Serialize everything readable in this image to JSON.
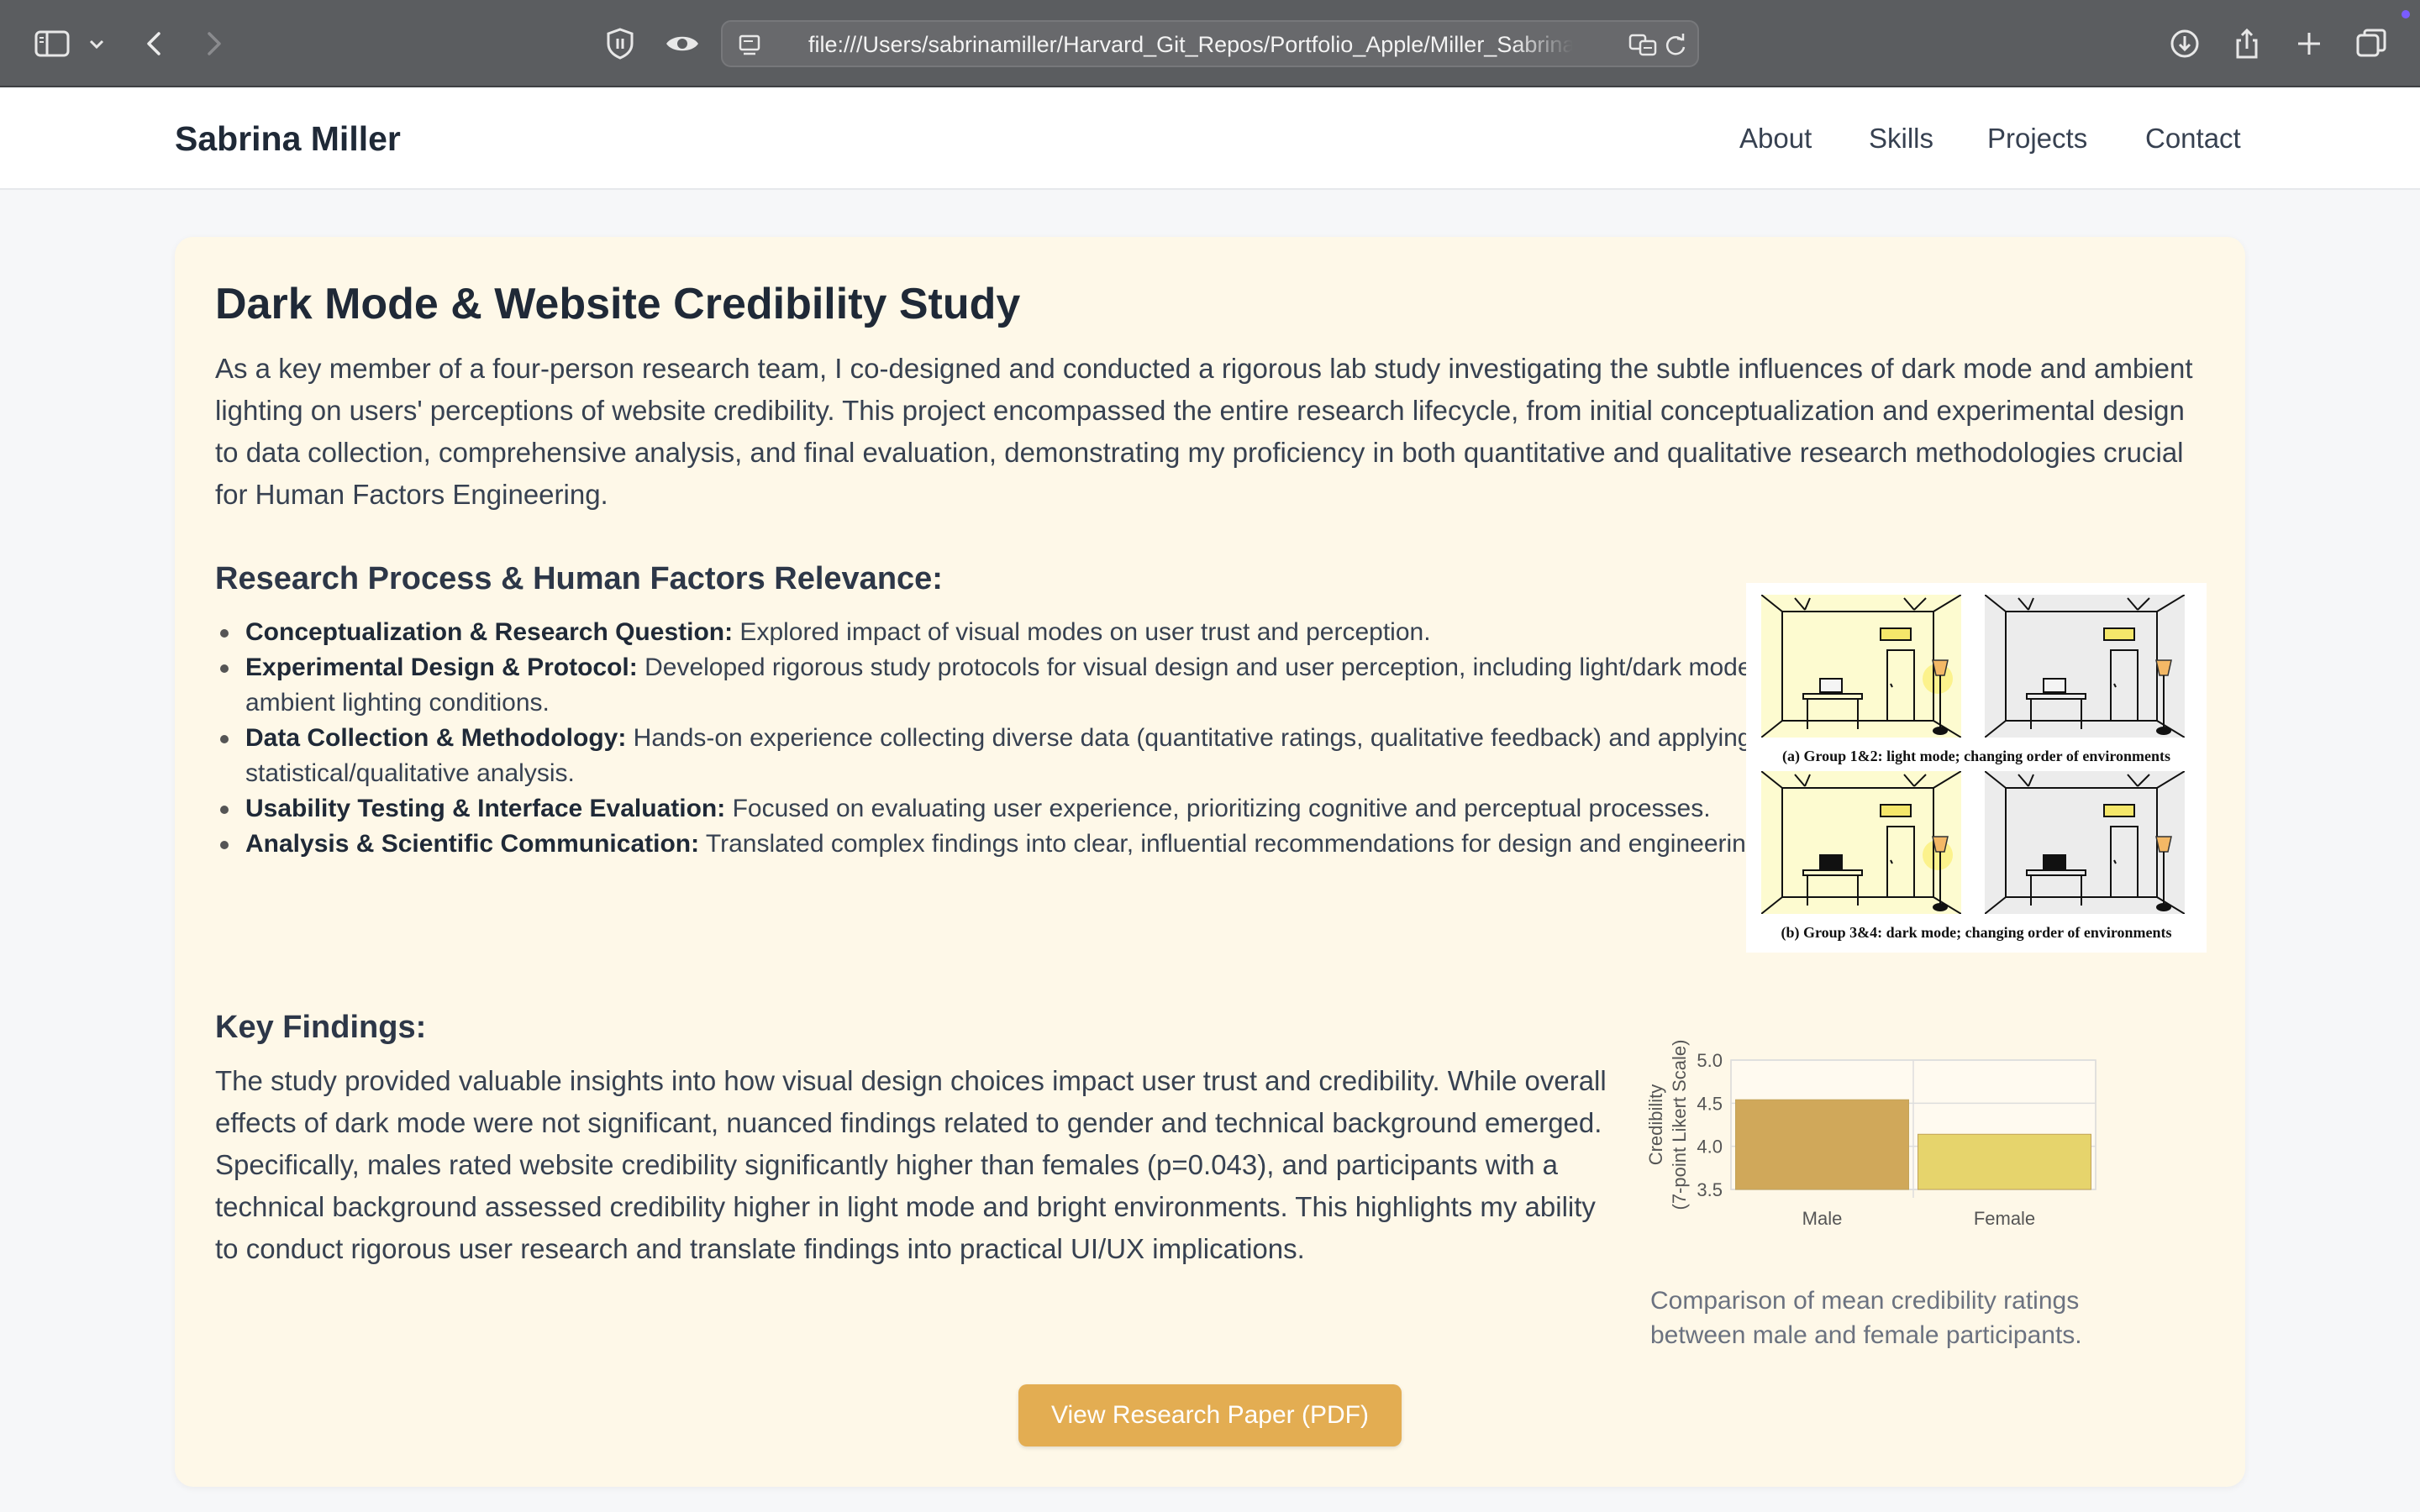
{
  "browser": {
    "url": "file:///Users/sabrinamiller/Harvard_Git_Repos/Portfolio_Apple/Miller_Sabrina_Portfolio.html",
    "icons": [
      "sidebar-icon",
      "chevron-down-icon",
      "back-icon",
      "forward-icon",
      "shield-icon",
      "eye-icon",
      "page-icon",
      "translate-icon",
      "reload-icon",
      "download-icon",
      "share-icon",
      "plus-icon",
      "tabs-icon"
    ]
  },
  "site": {
    "brand": "Sabrina Miller",
    "nav": [
      "About",
      "Skills",
      "Projects",
      "Contact"
    ]
  },
  "project": {
    "title": "Dark Mode & Website Credibility Study",
    "intro": "As a key member of a four-person research team, I co-designed and conducted a rigorous lab study investigating the subtle influences of dark mode and ambient lighting on users' perceptions of website credibility. This project encompassed the entire research lifecycle, from initial conceptualization and experimental design to data collection, comprehensive analysis, and final evaluation, demonstrating my proficiency in both quantitative and qualitative research methodologies crucial for Human Factors Engineering.",
    "process_title": "Research Process & Human Factors Relevance:",
    "bullets": [
      {
        "label": "Conceptualization & Research Question:",
        "text": " Explored impact of visual modes on user trust and perception."
      },
      {
        "label": "Experimental Design & Protocol:",
        "text": " Developed rigorous study protocols for visual design and user perception, including light/dark mode and ambient lighting conditions."
      },
      {
        "label": "Data Collection & Methodology:",
        "text": " Hands-on experience collecting diverse data (quantitative ratings, qualitative feedback) and applying advanced statistical/qualitative analysis."
      },
      {
        "label": "Usability Testing & Interface Evaluation:",
        "text": " Focused on evaluating user experience, prioritizing cognitive and perceptual processes."
      },
      {
        "label": "Analysis & Scientific Communication:",
        "text": " Translated complex findings into clear, influential recommendations for design and engineering teams."
      }
    ],
    "figure": {
      "caption_a": "(a) Group 1&2: light mode; changing order of environments",
      "caption_b": "(b) Group 3&4: dark mode; changing order of environments"
    },
    "findings_title": "Key Findings:",
    "findings": "The study provided valuable insights into how visual design choices impact user trust and credibility. While overall effects of dark mode were not significant, nuanced findings related to gender and technical background emerged. Specifically, males rated website credibility significantly higher than females (p=0.043), and participants with a technical background assessed credibility higher in light mode and bright environments. This highlights my ability to conduct rigorous user research and translate findings into practical UI/UX implications.",
    "chart_caption": "Comparison of mean credibility ratings between male and female participants.",
    "pdf_button": "View Research Paper (PDF)"
  },
  "chart_data": {
    "type": "bar",
    "categories": [
      "Male",
      "Female"
    ],
    "values": [
      4.54,
      4.14
    ],
    "colors": [
      "#d0a85a",
      "#e6d46c"
    ],
    "ylabel": "Credibility (7-point Likert Scale)",
    "ylabel_lines": [
      "Credibility",
      "(7-point Likert Scale)"
    ],
    "ylim": [
      3.5,
      5.0
    ],
    "yticks": [
      "3.5",
      "4.0",
      "4.5",
      "5.0"
    ],
    "grid": true
  },
  "colors": {
    "card_bg": "#fef8e8",
    "button": "#e3ad52",
    "browser_toolbar": "#5b5d60"
  }
}
